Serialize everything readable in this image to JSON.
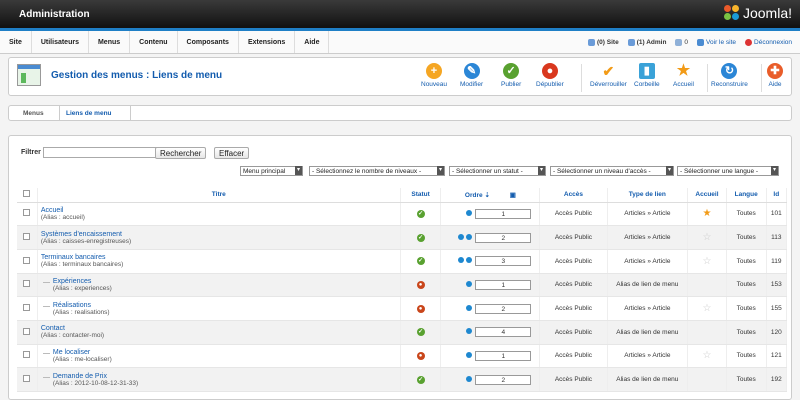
{
  "app": {
    "title": "Administration",
    "brand": "Joomla!"
  },
  "menubar": {
    "items": [
      "Site",
      "Utilisateurs",
      "Menus",
      "Contenu",
      "Composants",
      "Extensions",
      "Aide"
    ],
    "status": {
      "site_visitors": "(0) Site",
      "admin_users": "(1) Admin",
      "messages": "0",
      "view_site": "Voir le site",
      "logout": "Déconnexion"
    }
  },
  "toolbar": {
    "title": "Gestion des menus : Liens de menu",
    "buttons": {
      "new": "Nouveau",
      "edit": "Modifier",
      "publish": "Publier",
      "unpublish": "Dépublier",
      "unlock": "Déverrouiller",
      "trash": "Corbeille",
      "home": "Accueil",
      "rebuild": "Reconstruire",
      "help": "Aide"
    }
  },
  "subnav": {
    "menus": "Menus",
    "menu_items": "Liens de menu"
  },
  "filters": {
    "label": "Filtrer :",
    "search_button": "Rechercher",
    "clear_button": "Effacer",
    "menu_select": "Menu principal",
    "levels_select": "- Sélectionnez le nombre de niveaux -",
    "status_select": "- Sélectionner un statut -",
    "access_select": "- Sélectionner un niveau d'accès -",
    "language_select": "- Sélectionner une langue -"
  },
  "table": {
    "headers": {
      "title": "Titre",
      "status": "Statut",
      "order": "Ordre",
      "access": "Accès",
      "type": "Type de lien",
      "home": "Accueil",
      "language": "Langue",
      "id": "Id"
    },
    "rows": [
      {
        "title": "Accueil",
        "alias": "(Alias : accueil)",
        "status": "published",
        "arrows": 1,
        "order": "1",
        "access": "Accès Public",
        "type": "Articles » Article",
        "home": true,
        "language": "Toutes",
        "id": "101",
        "indent": false
      },
      {
        "title": "Systèmes d'encaissement",
        "alias": "(Alias : caisses-enregistreuses)",
        "status": "published",
        "arrows": 2,
        "order": "2",
        "access": "Accès Public",
        "type": "Articles » Article",
        "home": false,
        "language": "Toutes",
        "id": "113",
        "indent": false
      },
      {
        "title": "Terminaux bancaires",
        "alias": "(Alias : terminaux bancaires)",
        "status": "published",
        "arrows": 2,
        "order": "3",
        "access": "Accès Public",
        "type": "Articles » Article",
        "home": false,
        "language": "Toutes",
        "id": "119",
        "indent": false
      },
      {
        "title": "Expériences",
        "alias": "(Alias : experiences)",
        "status": "unpublished",
        "arrows": 1,
        "order": "1",
        "access": "Accès Public",
        "type": "Alias de lien de menu",
        "home": null,
        "language": "Toutes",
        "id": "153",
        "indent": true
      },
      {
        "title": "Réalisations",
        "alias": "(Alias : realisations)",
        "status": "unpublished",
        "arrows": 1,
        "order": "2",
        "access": "Accès Public",
        "type": "Articles » Article",
        "home": false,
        "language": "Toutes",
        "id": "155",
        "indent": true
      },
      {
        "title": "Contact",
        "alias": "(Alias : contacter-moi)",
        "status": "published",
        "arrows": 1,
        "order": "4",
        "access": "Accès Public",
        "type": "Alias de lien de menu",
        "home": null,
        "language": "Toutes",
        "id": "120",
        "indent": false
      },
      {
        "title": "Me localiser",
        "alias": "(Alias : me-localiser)",
        "status": "unpublished",
        "arrows": 1,
        "order": "1",
        "access": "Accès Public",
        "type": "Articles » Article",
        "home": false,
        "language": "Toutes",
        "id": "121",
        "indent": true
      },
      {
        "title": "Demande de Prix",
        "alias": "(Alias : 2012-10-08-12-31-33)",
        "status": "published",
        "arrows": 1,
        "order": "2",
        "access": "Accès Public",
        "type": "Alias de lien de menu",
        "home": null,
        "language": "Toutes",
        "id": "192",
        "indent": true
      }
    ]
  },
  "colors": {
    "accent": "#1f7fc6",
    "link": "#135cae",
    "published": "#59a130",
    "unpublished": "#c9461b",
    "star": "#f29b17"
  }
}
